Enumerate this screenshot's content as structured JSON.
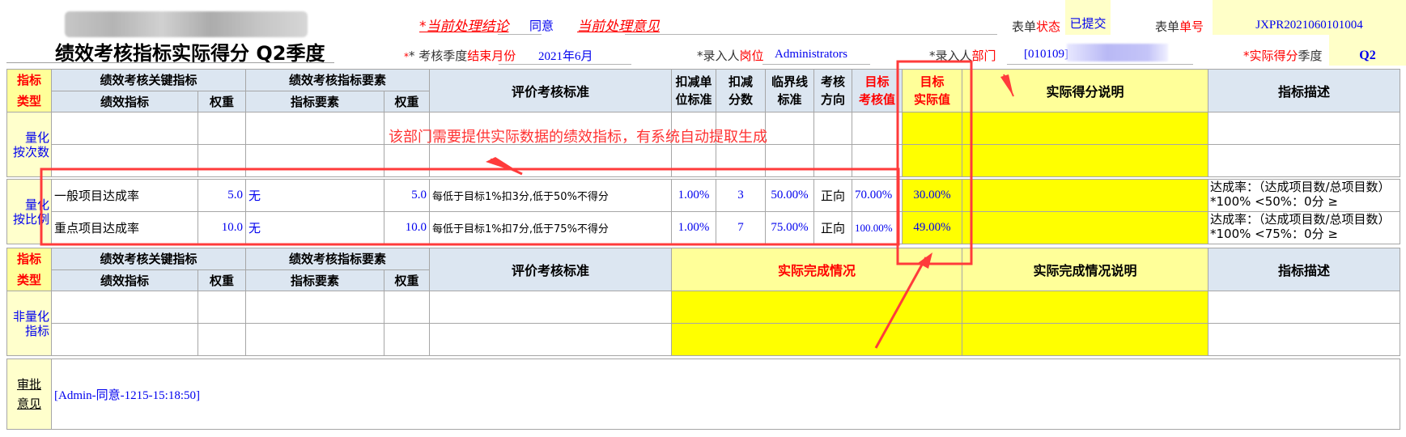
{
  "header": {
    "title": "绩效考核指标实际得分 Q2季度",
    "conclusion_label": "*当前处理结论",
    "conclusion_value": "同意",
    "opinion_label": "当前处理意见",
    "opinion_value": "",
    "status_label_a": "表单",
    "status_label_b": "状态",
    "status_value": "已提交",
    "number_label_a": "表单",
    "number_label_b": "单号",
    "number_value": "JXPR2021060101004",
    "end_month_label_a": "* 考核季度",
    "end_month_label_b": "结束月份",
    "end_month_value": "2021年6月",
    "position_label_a": "*录入人",
    "position_label_b": "岗位",
    "position_value": "Administrators",
    "dept_label_a": "*录入人",
    "dept_label_b": "部门",
    "dept_value": "[010109]",
    "quarter_label_a": "*实际得分",
    "quarter_label_b": "季度",
    "quarter_value": "Q2"
  },
  "quant_table": {
    "type_header": [
      "指标",
      "类型"
    ],
    "group_headers": [
      "绩效考核关键指标",
      "绩效考核指标要素"
    ],
    "columns": {
      "indicator": "绩效指标",
      "weight": "权重",
      "element": "指标要素",
      "element_weight": "权重",
      "criteria": "评价考核标准",
      "deduct_unit": [
        "扣减单",
        "位标准"
      ],
      "deduct_score": [
        "扣减",
        "分数"
      ],
      "threshold": [
        "临界线",
        "标准"
      ],
      "direction": [
        "考核",
        "方向"
      ],
      "target": [
        "目标",
        "考核值"
      ],
      "actual": [
        "目标",
        "实际值"
      ],
      "score_note": "实际得分说明",
      "description": "指标描述"
    },
    "sections": [
      {
        "type_label": [
          "量化",
          "按次数"
        ],
        "rows": [
          {
            "indicator": "",
            "weight": "",
            "element": "",
            "element_weight": "",
            "criteria": "",
            "deduct_unit": "",
            "deduct_score": "",
            "threshold": "",
            "direction": "",
            "target": "",
            "actual": "",
            "score_note": "",
            "description": ""
          },
          {
            "indicator": "",
            "weight": "",
            "element": "",
            "element_weight": "",
            "criteria": "",
            "deduct_unit": "",
            "deduct_score": "",
            "threshold": "",
            "direction": "",
            "target": "",
            "actual": "",
            "score_note": "",
            "description": ""
          }
        ]
      },
      {
        "type_label": [
          "量化",
          "按比例"
        ],
        "rows": [
          {
            "indicator": "一般项目达成率",
            "weight": "5.0",
            "element": "无",
            "element_weight": "5.0",
            "criteria": "每低于目标1%扣3分,低于50%不得分",
            "deduct_unit": "1.00%",
            "deduct_score": "3",
            "threshold": "50.00%",
            "direction": "正向",
            "target": "70.00%",
            "actual": "30.00%",
            "score_note": "",
            "description": "达成率：（达成项目数/总项目数）*100% <50%：0分 ≥"
          },
          {
            "indicator": "重点项目达成率",
            "weight": "10.0",
            "element": "无",
            "element_weight": "10.0",
            "criteria": "每低于目标1%扣7分,低于75%不得分",
            "deduct_unit": "1.00%",
            "deduct_score": "7",
            "threshold": "75.00%",
            "direction": "正向",
            "target": "100.00%",
            "actual": "49.00%",
            "score_note": "",
            "description": "达成率：（达成项目数/总项目数）*100% <75%：0分 ≥"
          }
        ]
      }
    ]
  },
  "nonquant_table": {
    "type_header": [
      "指标",
      "类型"
    ],
    "group_headers": [
      "绩效考核关键指标",
      "绩效考核指标要素"
    ],
    "columns": {
      "indicator": "绩效指标",
      "weight": "权重",
      "element": "指标要素",
      "element_weight": "权重",
      "criteria": "评价考核标准",
      "completion": "实际完成情况",
      "completion_note": "实际完成情况说明",
      "description": "指标描述"
    },
    "type_label": [
      "非量化",
      "指标"
    ],
    "rows": [
      {
        "indicator": "",
        "weight": "",
        "element": "",
        "element_weight": "",
        "criteria": "",
        "completion": "",
        "completion_note": "",
        "description": ""
      },
      {
        "indicator": "",
        "weight": "",
        "element": "",
        "element_weight": "",
        "criteria": "",
        "completion": "",
        "completion_note": "",
        "description": ""
      }
    ]
  },
  "approval": {
    "label": [
      "审批",
      "意见"
    ],
    "entries": "[Admin-同意-1215-15:18:50]"
  },
  "annotation": {
    "text": "该部门需要提供实际数据的绩效指标，有系统自动提取生成",
    "color": "#ff3333"
  },
  "colors": {
    "header_blue": "#dce6f1",
    "light_yellow": "#ffff99",
    "bright_yellow": "#ffff00",
    "required_red": "#ff0000",
    "value_blue": "#0000ee"
  }
}
